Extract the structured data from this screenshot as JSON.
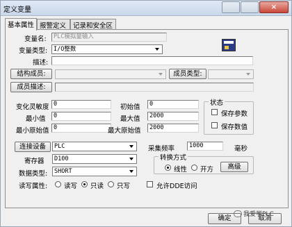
{
  "window": {
    "title": "定义变量",
    "close_glyph": "×"
  },
  "tabs": [
    {
      "label": "基本属性",
      "active": true
    },
    {
      "label": "报警定义",
      "active": false
    },
    {
      "label": "记录和安全区",
      "active": false
    }
  ],
  "basic": {
    "var_name_label": "变量名:",
    "var_name_value": "PLC模拟量输入",
    "var_type_label": "变量类型:",
    "var_type_value": "I/O整数",
    "desc_label": "描述:",
    "desc_value": "",
    "struct_member_label": "结构成员:",
    "member_type_label": "成员类型:",
    "member_desc_label": "成员描述:"
  },
  "range": {
    "sensitivity_label": "变化灵敏度",
    "sensitivity_value": "0",
    "min_label": "最小值",
    "min_value": "0",
    "min_raw_label": "最小原始值",
    "min_raw_value": "0",
    "init_label": "初始值",
    "init_value": "0",
    "max_label": "最大值",
    "max_value": "2000",
    "max_raw_label": "最大原始值",
    "max_raw_value": "2000"
  },
  "status": {
    "group_label": "状态",
    "save_param_label": "保存参数",
    "save_value_label": "保存数值"
  },
  "io": {
    "device_button": "连接设备",
    "device_value": "PLC",
    "register_label": "寄存器",
    "register_value": "D100",
    "datatype_label": "数据类型:",
    "datatype_value": "SHORT",
    "rw_label": "读写属性:",
    "read_write_label": "读写",
    "read_only_label": "只读",
    "write_only_label": "只写",
    "rw_selected": "只读",
    "sample_label": "采集频率",
    "sample_value": "1000",
    "sample_unit": "毫秒",
    "convert_group_label": "转换方式",
    "linear_label": "线性",
    "sqrt_label": "开方",
    "convert_selected": "线性",
    "advanced_button": "高级",
    "ddex_label": "允许DDE访问"
  },
  "footer": {
    "ok_button": "确定",
    "cancel_button": "取消",
    "watermark": "我爱学PLC"
  },
  "colors": {
    "window_bg": "#f0f0f0",
    "titlebar": "#c9d8ea",
    "close": "#c9483a"
  }
}
